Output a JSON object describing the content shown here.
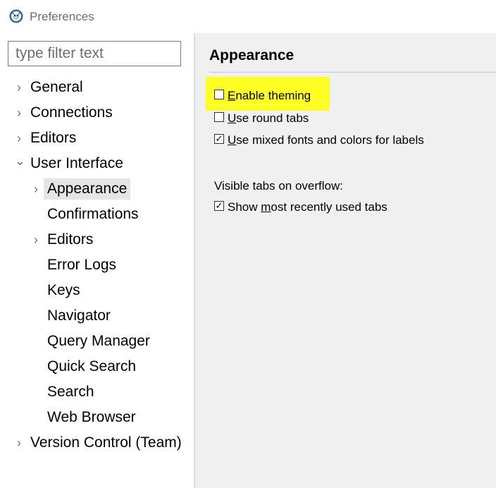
{
  "window": {
    "title": "Preferences",
    "icon": "app-logo-icon"
  },
  "filter": {
    "placeholder": "type filter text",
    "value": ""
  },
  "tree": {
    "items": [
      {
        "label": "General",
        "expander": "collapsed"
      },
      {
        "label": "Connections",
        "expander": "collapsed"
      },
      {
        "label": "Editors",
        "expander": "collapsed"
      },
      {
        "label": "User Interface",
        "expander": "expanded"
      },
      {
        "label": "Appearance",
        "expander": "collapsed",
        "selected": true
      },
      {
        "label": "Confirmations",
        "expander": "none"
      },
      {
        "label": "Editors",
        "expander": "collapsed"
      },
      {
        "label": "Error Logs",
        "expander": "none"
      },
      {
        "label": "Keys",
        "expander": "none"
      },
      {
        "label": "Navigator",
        "expander": "none"
      },
      {
        "label": "Query Manager",
        "expander": "none"
      },
      {
        "label": "Quick Search",
        "expander": "none"
      },
      {
        "label": "Search",
        "expander": "none"
      },
      {
        "label": "Web Browser",
        "expander": "none"
      },
      {
        "label": "Version Control (Team)",
        "expander": "collapsed"
      }
    ],
    "chevron_collapsed": "›",
    "chevron_expanded": "⌄"
  },
  "page": {
    "title": "Appearance",
    "highlight_color": "#ffff26",
    "options": [
      {
        "pre": "",
        "mnemonic": "E",
        "post": "nable theming",
        "checked": false,
        "highlighted": true
      },
      {
        "pre": "",
        "mnemonic": "U",
        "post": "se round tabs",
        "checked": false
      },
      {
        "pre": "",
        "mnemonic": "U",
        "post": "se mixed fonts and colors for labels",
        "checked": true
      }
    ],
    "overflow_group_label": "Visible tabs on overflow:",
    "overflow_options": [
      {
        "pre": "Show ",
        "mnemonic": "m",
        "post": "ost recently used tabs",
        "checked": true
      }
    ],
    "check_glyph": "✓"
  }
}
